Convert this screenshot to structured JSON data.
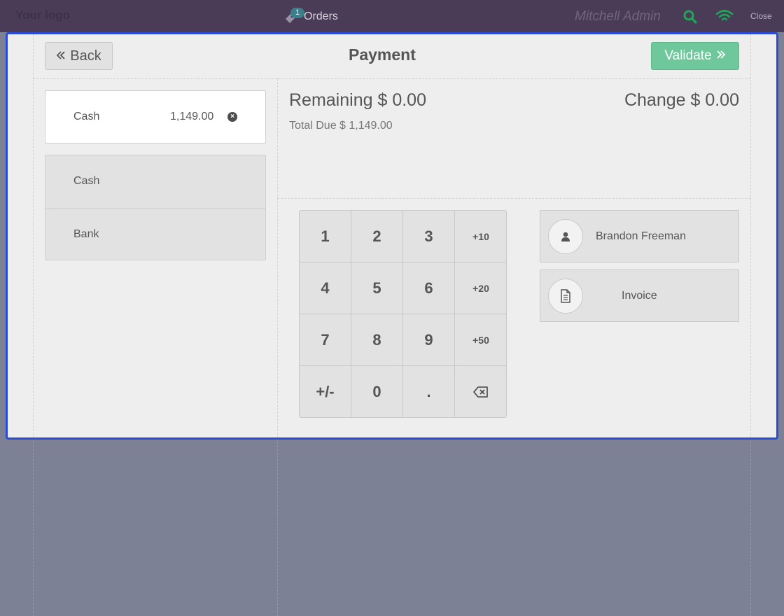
{
  "navbar": {
    "logo": "Your logo",
    "orders_label": "Orders",
    "orders_count": "1",
    "user": "Mitchell Admin",
    "close_label": "Close"
  },
  "payment": {
    "title": "Payment",
    "back_label": "Back",
    "validate_label": "Validate",
    "lines": [
      {
        "method": "Cash",
        "amount": "1,149.00"
      }
    ],
    "methods": [
      "Cash",
      "Bank"
    ],
    "remaining_label": "Remaining",
    "remaining_value": "$ 0.00",
    "change_label": "Change",
    "change_value": "$ 0.00",
    "total_due_label": "Total Due",
    "total_due_value": "$ 1,149.00",
    "customer": "Brandon Freeman",
    "invoice_label": "Invoice"
  },
  "numpad": {
    "keys": [
      "1",
      "2",
      "3",
      "+10",
      "4",
      "5",
      "6",
      "+20",
      "7",
      "8",
      "9",
      "+50",
      "+/-",
      "0",
      "."
    ]
  },
  "colors": {
    "navbar": "#4a3c57",
    "accent_border": "#2a4bd7",
    "validate": "#6ec89b",
    "wifi": "#22a35a"
  }
}
